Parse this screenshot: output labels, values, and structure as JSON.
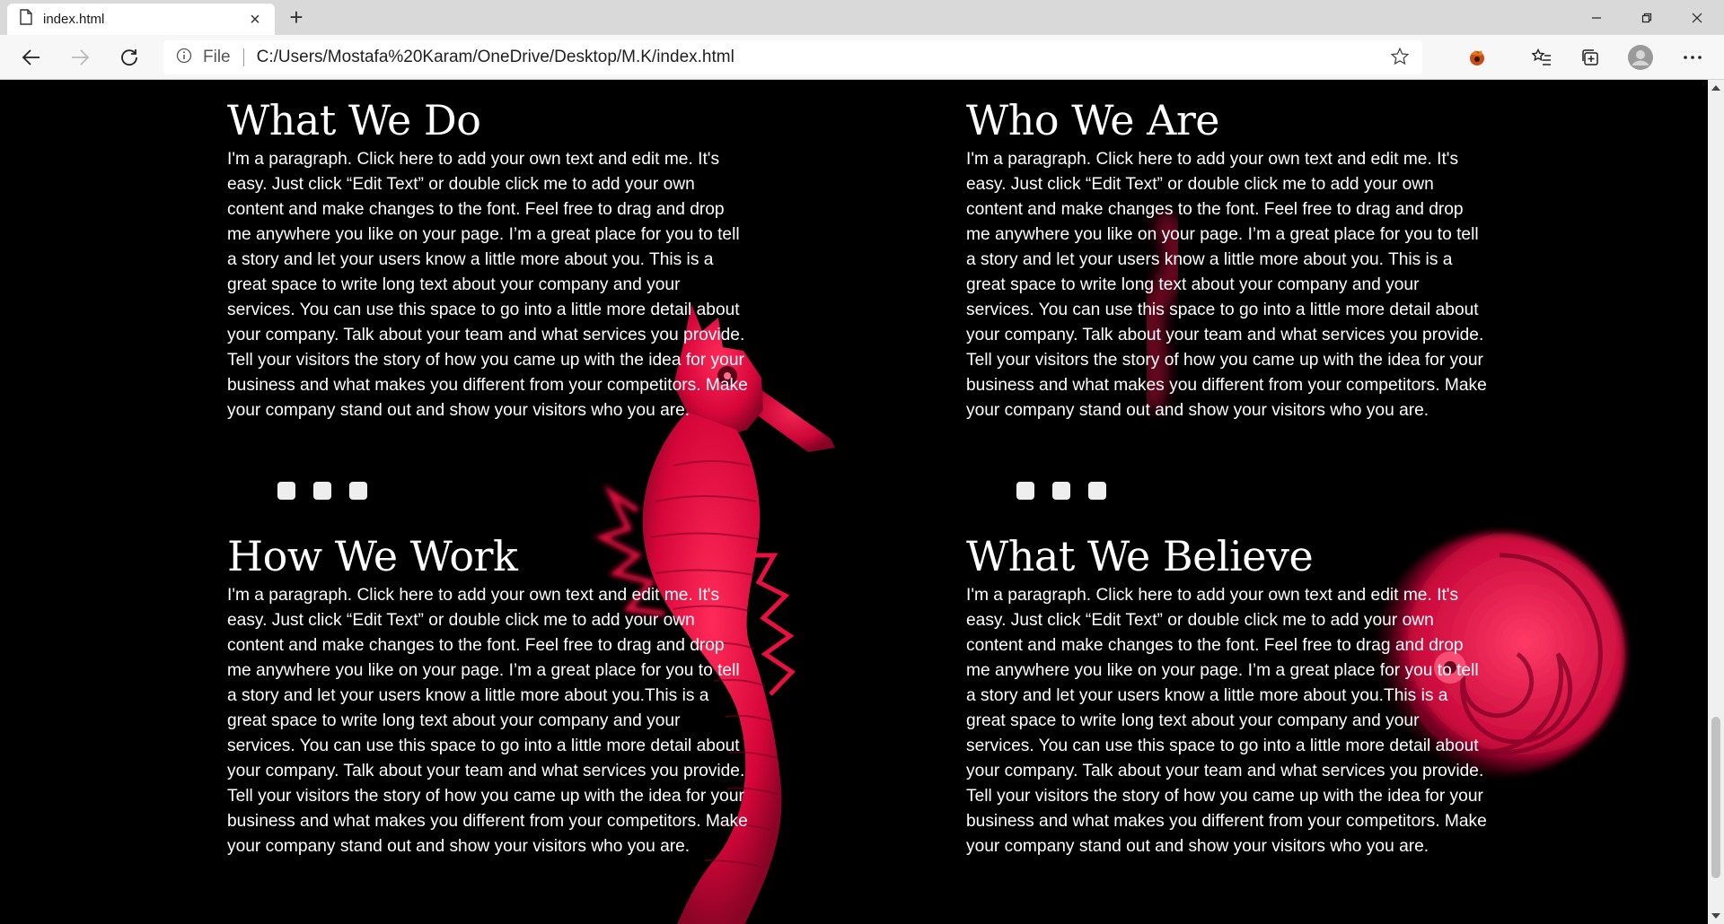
{
  "browser": {
    "tab_title": "index.html",
    "address_scheme": "File",
    "address_url": "C:/Users/Mostafa%20Karam/OneDrive/Desktop/M.K/index.html"
  },
  "colors": {
    "accent": "#e8103f",
    "page_bg": "#000000",
    "text": "#ffffff"
  },
  "sections": [
    {
      "title": "What We Do",
      "body": "I'm a paragraph. Click here to add your own text and edit me. It's easy. Just click “Edit Text” or double click me to add your own content and make changes to the font. Feel free to drag and drop me anywhere you like on your page. I’m a great place for you to tell a story and let your users know a little more about you. This is a great space to write long text about your company and your services. You can use this space to go into a little more detail about your company. Talk about your team and what services you provide. Tell your visitors the story of how you came up with the idea for your business and what makes you different from your competitors. Make your company stand out and show your visitors who you are."
    },
    {
      "title": "Who We Are",
      "body": "I'm a paragraph. Click here to add your own text and edit me. It's easy. Just click “Edit Text” or double click me to add your own content and make changes to the font. Feel free to drag and drop me anywhere you like on your page. I’m a great place for you to tell a story and let your users know a little more about you. This is a great space to write long text about your company and your services. You can use this space to go into a little more detail about your company. Talk about your team and what services you provide. Tell your visitors the story of how you came up with the idea for your business and what makes you different from your competitors. Make your company stand out and show your visitors who you are."
    },
    {
      "title": "How We Work",
      "body": "I'm a paragraph. Click here to add your own text and edit me. It's easy. Just click “Edit Text” or double click me to add your own content and make changes to the font. Feel free to drag and drop me anywhere you like on your page. I’m a great place for you to tell a story and let your users know a little more about you.This is a great space to write long text about your company and your services. You can use this space to go into a little more detail about your company. Talk about your team and what services you provide. Tell your visitors the story of how you came up with the idea for your business and what makes you different from your competitors. Make your company stand out and show your visitors who you are."
    },
    {
      "title": "What We Believe",
      "body": "I'm a paragraph. Click here to add your own text and edit me. It's easy. Just click “Edit Text” or double click me to add your own content and make changes to the font. Feel free to drag and drop me anywhere you like on your page. I’m a great place for you to tell a story and let your users know a little more about you.This is a great space to write long text about your company and your services. You can use this space to go into a little more detail about your company. Talk about your team and what services you provide. Tell your visitors the story of how you came up with the idea for your business and what makes you different from your competitors. Make your company stand out and show your visitors who you are."
    }
  ],
  "icons": {
    "tab": "file-icon",
    "tab_close": "close-icon",
    "new_tab": "plus-icon",
    "back": "back-arrow-icon",
    "forward": "forward-arrow-icon",
    "refresh": "refresh-icon",
    "info": "info-icon",
    "favorite": "star-icon",
    "extension": "extension-icon",
    "favorites": "favorites-list-icon",
    "collections": "collections-icon",
    "profile": "profile-icon",
    "menu": "more-icon"
  }
}
